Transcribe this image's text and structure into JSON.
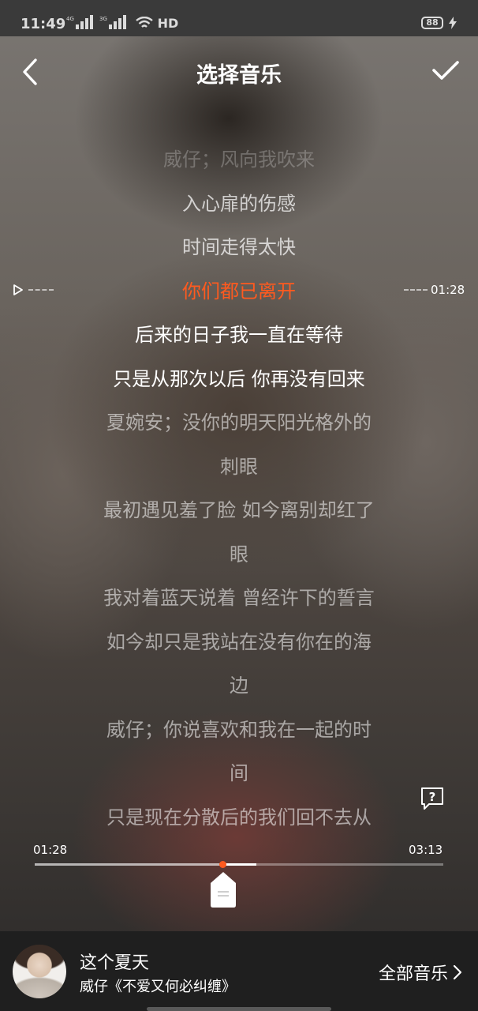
{
  "status_bar": {
    "time": "11:49",
    "network": "HD",
    "battery": "88"
  },
  "header": {
    "title": "选择音乐",
    "back_icon": "chevron-left-icon",
    "confirm_icon": "checkmark-icon"
  },
  "lyrics": {
    "lines": [
      "威仔；风向我吹来",
      "入心扉的伤感",
      "时间走得太快",
      "你们都已离开",
      "后来的日子我一直在等待",
      "只是从那次以后 你再没有回来",
      "夏婉安；没你的明天阳光格外的",
      "刺眼",
      "最初遇见羞了脸  如今离别却红了",
      "眼",
      "我对着蓝天说着  曾经许下的誓言",
      "如今却只是我站在没有你在的海",
      "边",
      "威仔；你说喜欢和我在一起的时",
      "间",
      "只是现在分散后的我们回不去从"
    ],
    "current_index": 3,
    "marker_time": "01:28"
  },
  "player": {
    "start_time": "01:28",
    "end_time": "03:13",
    "progress_fraction": 0.4597,
    "selection_end_fraction": 0.5426,
    "accent_color": "#ff5a1f"
  },
  "song": {
    "title": "这个夏天",
    "subtitle": "威仔《不爱又何必纠缠》",
    "all_music_label": "全部音乐"
  }
}
